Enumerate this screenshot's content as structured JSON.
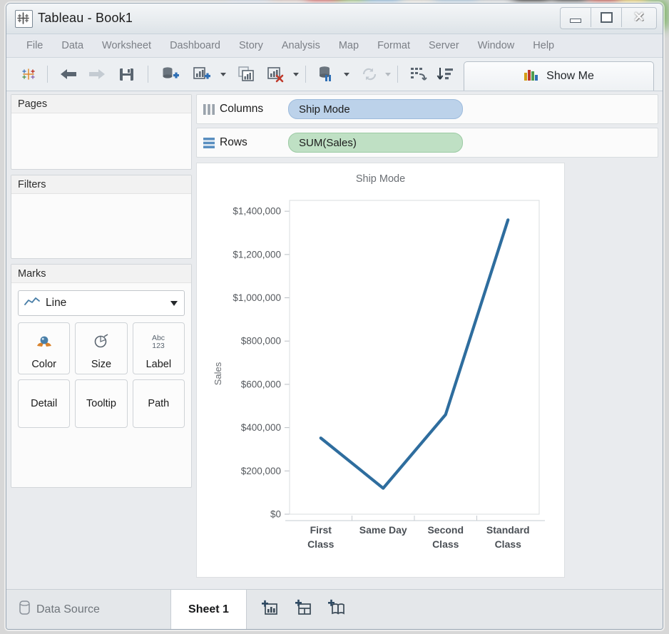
{
  "window": {
    "title": "Tableau - Book1",
    "icon": "tableau-logo-icon",
    "controls": {
      "minimize": "Minimize",
      "maximize": "Maximize",
      "close": "Close"
    }
  },
  "menu": {
    "items": [
      "File",
      "Data",
      "Worksheet",
      "Dashboard",
      "Story",
      "Analysis",
      "Map",
      "Format",
      "Server",
      "Window",
      "Help"
    ]
  },
  "toolbar": {
    "buttons": [
      {
        "name": "tableau-start-icon",
        "title": "Start page"
      },
      {
        "name": "back-arrow-icon",
        "title": "Undo"
      },
      {
        "name": "forward-arrow-icon",
        "title": "Redo"
      },
      {
        "name": "save-icon",
        "title": "Save"
      },
      {
        "name": "add-data-source-icon",
        "title": "New Data Source"
      },
      {
        "name": "new-worksheet-icon",
        "title": "New Worksheet"
      },
      {
        "name": "duplicate-sheet-icon",
        "title": "Duplicate Sheet"
      },
      {
        "name": "clear-sheet-icon",
        "title": "Clear Sheet"
      },
      {
        "name": "pause-refresh-icon",
        "title": "Pause Auto Updates"
      },
      {
        "name": "refresh-icon",
        "title": "Refresh Data Source"
      },
      {
        "name": "swap-rows-columns-icon",
        "title": "Swap Rows and Columns"
      },
      {
        "name": "sort-descending-icon",
        "title": "Sort Descending"
      }
    ],
    "show_me_label": "Show Me",
    "show_me_icon": "bar-chart-icon"
  },
  "panels": {
    "pages": {
      "title": "Pages"
    },
    "filters": {
      "title": "Filters"
    },
    "marks": {
      "title": "Marks",
      "mark_type": "Line",
      "mark_type_icon": "line-chart-icon",
      "buttons": [
        {
          "label": "Color",
          "icon": "color-palette-icon"
        },
        {
          "label": "Size",
          "icon": "size-circle-icon"
        },
        {
          "label": "Label",
          "icon": "abc-123-icon"
        },
        {
          "label": "Detail",
          "icon": ""
        },
        {
          "label": "Tooltip",
          "icon": ""
        },
        {
          "label": "Path",
          "icon": ""
        }
      ]
    }
  },
  "shelves": {
    "columns": {
      "label": "Columns",
      "icon": "columns-icon",
      "pill": "Ship Mode",
      "pill_type": "dimension"
    },
    "rows": {
      "label": "Rows",
      "icon": "rows-icon",
      "pill": "SUM(Sales)",
      "pill_type": "measure"
    }
  },
  "status_bar": {
    "data_source_label": "Data Source",
    "data_source_icon": "database-icon",
    "sheet_tab_label": "Sheet 1",
    "new_tabs": [
      {
        "name": "new-worksheet-tab-icon"
      },
      {
        "name": "new-dashboard-tab-icon"
      },
      {
        "name": "new-story-tab-icon"
      }
    ]
  },
  "colors": {
    "line": "#2e6d9e",
    "dimension_pill": "#bcd2ea",
    "measure_pill": "#bfe0c4",
    "axis_text": "#6b6f74",
    "tick_label": "#55595e"
  },
  "chart_data": {
    "type": "line",
    "title": "Ship Mode",
    "xlabel": "",
    "ylabel": "Sales",
    "categories": [
      "First Class",
      "Same Day",
      "Second Class",
      "Standard Class"
    ],
    "values": [
      352000,
      120000,
      460000,
      1360000
    ],
    "ylim": [
      0,
      1450000
    ],
    "yticks": [
      0,
      200000,
      400000,
      600000,
      800000,
      1000000,
      1200000,
      1400000
    ],
    "ytick_labels": [
      "$0",
      "$200,000",
      "$400,000",
      "$600,000",
      "$800,000",
      "$1,000,000",
      "$1,200,000",
      "$1,400,000"
    ],
    "grid": false,
    "legend": "none",
    "series": [
      {
        "name": "SUM(Sales)",
        "values": [
          352000,
          120000,
          460000,
          1360000
        ],
        "color": "#2e6d9e"
      }
    ]
  }
}
